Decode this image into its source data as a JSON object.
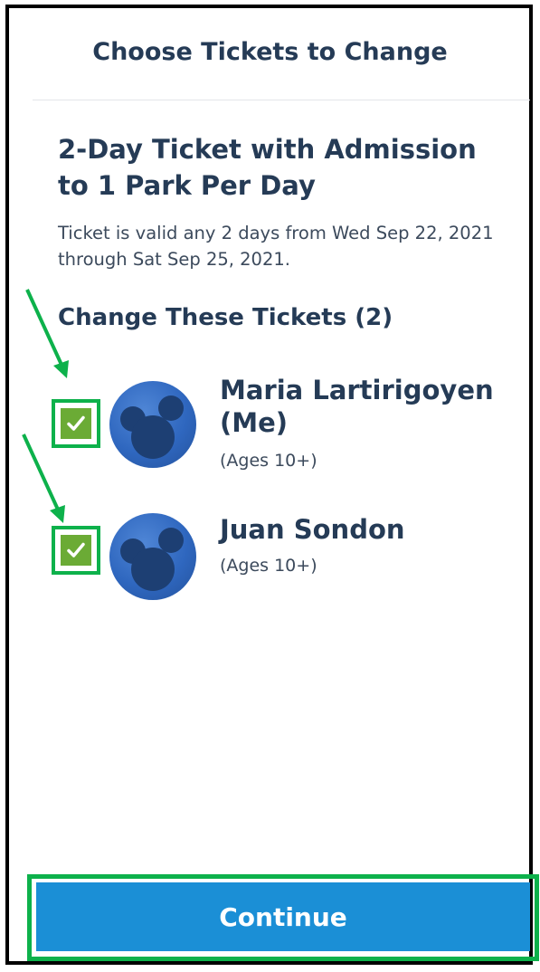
{
  "header": {
    "title": "Choose Tickets to Change"
  },
  "ticket": {
    "title": "2-Day Ticket with Admission to 1 Park Per Day",
    "description": "Ticket is valid any 2 days from Wed Sep 22, 2021 through Sat Sep 25, 2021."
  },
  "section": {
    "title": "Change These Tickets (2)"
  },
  "guests": [
    {
      "name": "Maria Lartirigoyen (Me)",
      "age": "(Ages 10+)",
      "checked": true,
      "avatar_icon": "mickey-silhouette-icon"
    },
    {
      "name": "Juan Sondon",
      "age": "(Ages 10+)",
      "checked": true,
      "avatar_icon": "mickey-silhouette-icon"
    }
  ],
  "footer": {
    "continue_label": "Continue"
  },
  "colors": {
    "text_primary": "#253b56",
    "checkbox_fill": "#6bab35",
    "highlight_green": "#0db14b",
    "button_blue": "#1b8fd6",
    "avatar_blue": "#2f67bf"
  }
}
